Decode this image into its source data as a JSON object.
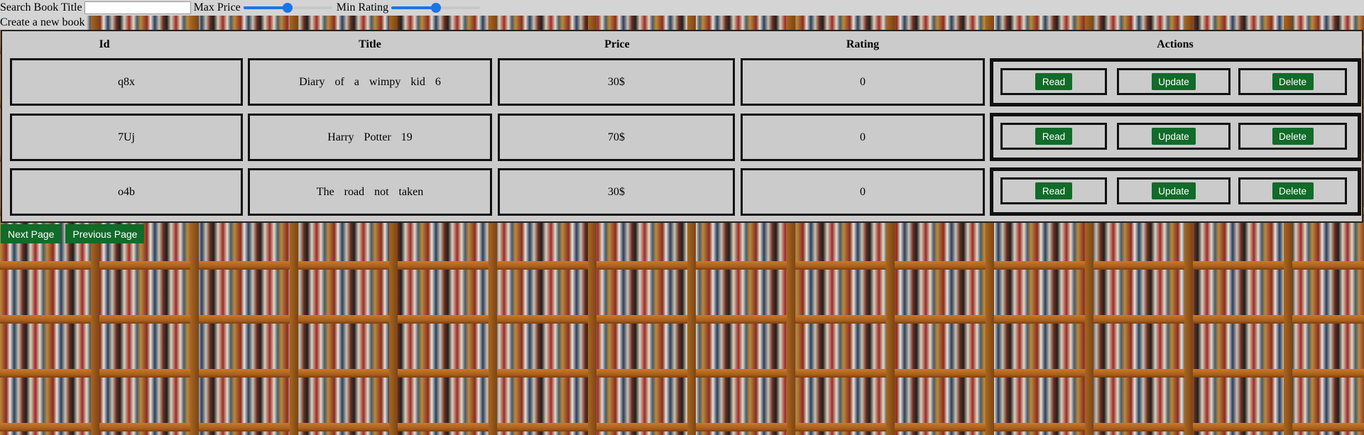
{
  "controls": {
    "search_label": "Search Book Title",
    "search_value": "",
    "search_placeholder": "",
    "max_price_label": "Max Price",
    "max_price_level": 0.5,
    "min_rating_label": "Min Rating",
    "min_rating_level": 0.5,
    "create_link": "Create a new book"
  },
  "table": {
    "headers": {
      "id": "Id",
      "title": "Title",
      "price": "Price",
      "rating": "Rating",
      "actions": "Actions"
    },
    "rows": [
      {
        "id": "q8x",
        "title": "Diary of a wimpy kid 6",
        "price": "30$",
        "rating": "0"
      },
      {
        "id": "7Uj",
        "title": "Harry Potter 19",
        "price": "70$",
        "rating": "0"
      },
      {
        "id": "o4b",
        "title": "The road not taken",
        "price": "30$",
        "rating": "0"
      }
    ],
    "action_labels": {
      "read": "Read",
      "update": "Update",
      "delete": "Delete"
    }
  },
  "pager": {
    "next": "Next Page",
    "previous": "Previous Page"
  },
  "colors": {
    "button_green": "#116b29",
    "slider_blue": "#1a73e8",
    "panel_gray": "#cbcbcb"
  }
}
